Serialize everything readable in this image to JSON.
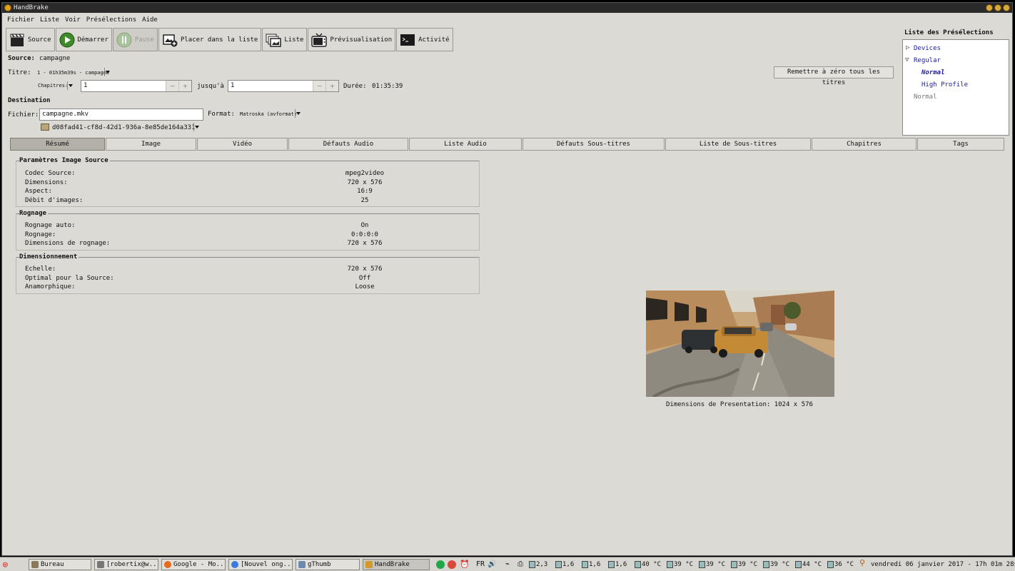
{
  "window": {
    "title": "HandBrake"
  },
  "menu": [
    "Fichier",
    "Liste",
    "Voir",
    "Présélections",
    "Aide"
  ],
  "toolbar": [
    {
      "label": "Source",
      "icon": "clapperboard-icon",
      "enabled": true
    },
    {
      "label": "Démarrer",
      "icon": "play-icon",
      "enabled": true
    },
    {
      "label": "Pause",
      "icon": "pause-icon",
      "enabled": false
    },
    {
      "label": "Placer dans la liste",
      "icon": "add-to-queue-icon",
      "enabled": true
    },
    {
      "label": "Liste",
      "icon": "queue-icon",
      "enabled": true
    },
    {
      "label": "Prévisualisation",
      "icon": "tv-icon",
      "enabled": true
    },
    {
      "label": "Activité",
      "icon": "terminal-icon",
      "enabled": true
    }
  ],
  "source": {
    "label": "Source:",
    "value": "campagne"
  },
  "title_row": {
    "label": "Titre:",
    "value": "1 - 01h35m39s - campagne"
  },
  "chapters": {
    "label": "Chapitres:",
    "from": "1",
    "to_label": "jusqu'à",
    "to": "1",
    "duration_label": "Durée:",
    "duration": "01:35:39"
  },
  "reset_button": "Remettre à zéro tous les titres",
  "destination": {
    "heading": "Destination",
    "file_label": "Fichier:",
    "file": "campagne.mkv",
    "format_label": "Format:",
    "format": "Matroska (avformat)",
    "folder": "d08fad41-cf8d-42d1-936a-8e85de164a331"
  },
  "tabs": [
    "Résumé",
    "Image",
    "Vidéo",
    "Défauts Audio",
    "Liste Audio",
    "Défauts Sous-titres",
    "Liste de Sous-titres",
    "Chapitres",
    "Tags"
  ],
  "active_tab": "Résumé",
  "summary": {
    "source_params": {
      "title": "Paramètres Image Source",
      "rows": [
        {
          "label": "Codec Source:",
          "value": "mpeg2video"
        },
        {
          "label": "Dimensions:",
          "value": "720 x 576"
        },
        {
          "label": "Aspect:",
          "value": "16:9"
        },
        {
          "label": "Débit d'images:",
          "value": "25"
        }
      ]
    },
    "cropping": {
      "title": "Rognage",
      "rows": [
        {
          "label": "Rognage auto:",
          "value": "On"
        },
        {
          "label": "Rognage:",
          "value": "0:0:0:0"
        },
        {
          "label": "Dimensions de rognage:",
          "value": "720 x 576"
        }
      ]
    },
    "scaling": {
      "title": "Dimensionnement",
      "rows": [
        {
          "label": "Echelle:",
          "value": "720 x 576"
        },
        {
          "label": "Optimal pour la Source:",
          "value": "Off"
        },
        {
          "label": "Anamorphique:",
          "value": "Loose"
        }
      ]
    },
    "presentation": "Dimensions de Presentation:  1024 x 576"
  },
  "presets": {
    "title": "Liste des Présélections",
    "groups": [
      {
        "name": "Devices",
        "expanded": false
      },
      {
        "name": "Regular",
        "expanded": true,
        "children": [
          "Normal",
          "High Profile"
        ]
      }
    ],
    "footer_item": "Normal",
    "selected": "Normal"
  },
  "taskbar": {
    "tasks": [
      "Bureau",
      "[robertix@w...",
      "Google - Mo...",
      "[Nouvel ong...",
      "gThumb",
      "HandBrake"
    ],
    "active_task": "HandBrake",
    "lang": "FR",
    "sensors": [
      "2,3",
      "1,6",
      "1,6",
      "1,6",
      "40 °C",
      "39 °C",
      "39 °C",
      "39 °C",
      "39 °C",
      "44 °C",
      "36 °C"
    ],
    "clock": "vendredi 06 janvier 2017 - 17h 01m 28s"
  },
  "colors": {
    "window_bg": "#dcdad5",
    "title_bar": "#2a2a2a",
    "preset_blue": "#1a1aa0",
    "active_tab": "#b3b0a8"
  }
}
